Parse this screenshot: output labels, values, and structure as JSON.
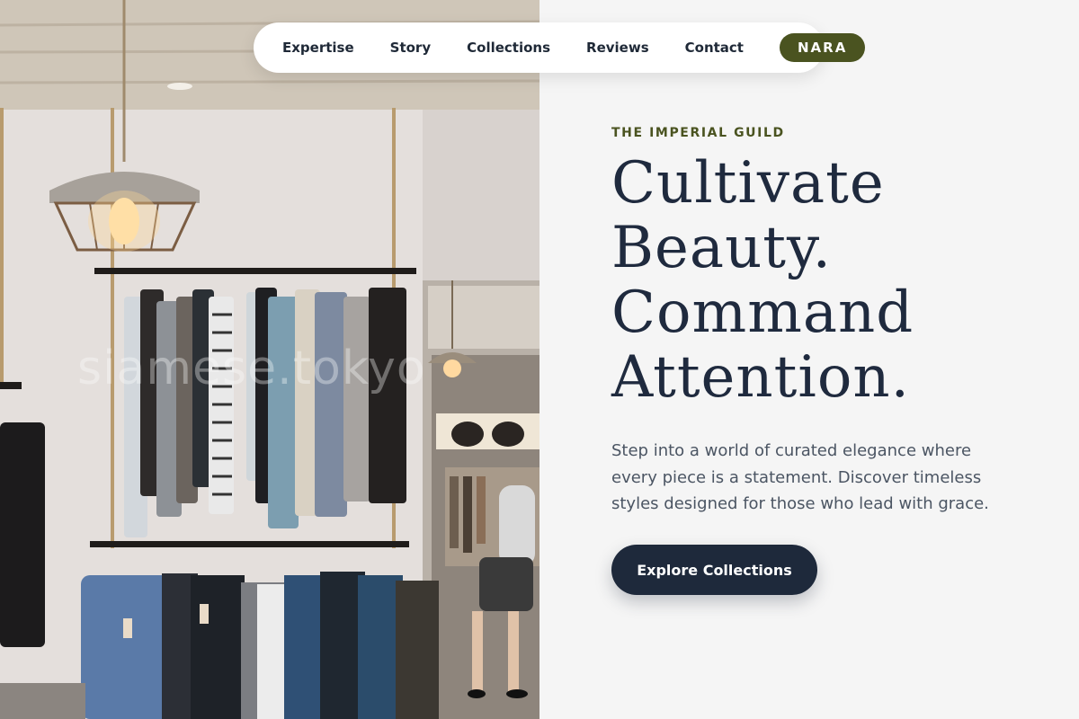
{
  "nav": {
    "links": [
      "Expertise",
      "Story",
      "Collections",
      "Reviews",
      "Contact"
    ],
    "brand": "NARA"
  },
  "hero": {
    "eyebrow": "THE IMPERIAL GUILD",
    "headline_lines": [
      "Cultivate",
      "Beauty.",
      "Command",
      "Attention."
    ],
    "lead": "Step into a world of curated elegance where every piece is a statement. Discover timeless styles designed for those who lead with grace.",
    "cta_label": "Explore Collections"
  },
  "photo": {
    "watermark": "siamese.tokyo",
    "icon": "clothing-store-photo"
  },
  "colors": {
    "accent_olive": "#4a5320",
    "navy": "#1e293b",
    "page_bg": "#f5f5f5"
  }
}
